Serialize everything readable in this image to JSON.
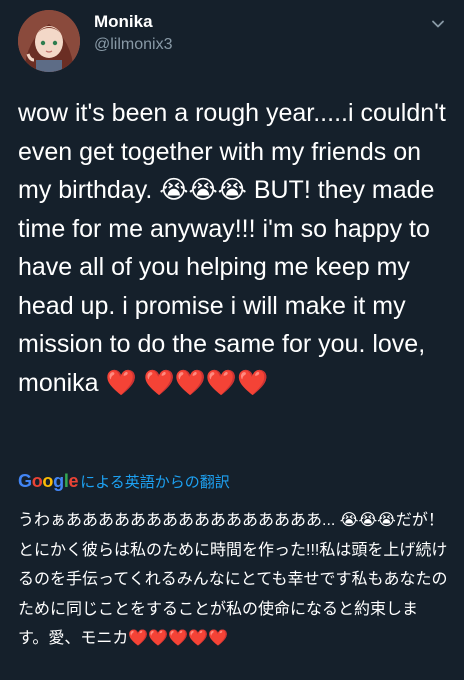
{
  "user": {
    "display_name": "Monika",
    "handle": "@lilmonix3"
  },
  "tweet": {
    "text": "wow it's been a rough year.....i couldn't even get together with my friends on my birthday. 😭😭😭 BUT! they made time for me anyway!!! i'm so happy to have all of you helping me keep my head up. i promise i will make it my mission to do the same for you. love, monika ❤️ ❤️❤️❤️❤️"
  },
  "translation": {
    "link_label": "による英語からの翻訳",
    "logo_text": "Google",
    "text": "うわぁああああああああああああああああ... 😭😭😭だが！とにかく彼らは私のために時間を作った!!!私は頭を上げ続けるのを手伝ってくれるみんなにとても幸せです私もあなたのために同じことをすることが私の使命になると約束します。愛、モニカ❤️❤️❤️❤️❤️"
  },
  "icons": {
    "avatar": "profile-avatar",
    "menu": "chevron-down-icon"
  },
  "colors": {
    "background": "#15202b",
    "secondary_text": "#8899a6",
    "link": "#1da1f2",
    "heart": "#e0245e"
  }
}
